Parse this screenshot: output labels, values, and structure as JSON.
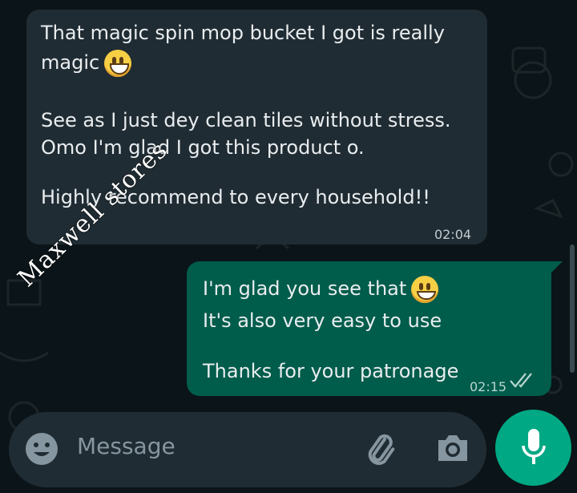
{
  "messages": {
    "incoming": {
      "lines": [
        "That magic spin mop bucket I got is really",
        "magic",
        "See as I just dey clean tiles without stress.",
        "Omo I'm glad I got this product o.",
        "Highly recommend to every household!!"
      ],
      "time": "02:04",
      "emoji": "grinning-face-icon"
    },
    "outgoing": {
      "lines": [
        "I'm glad you see that",
        "It's also very easy to use",
        "Thanks for your patronage"
      ],
      "time": "02:15",
      "status": "read-double-check",
      "emoji": "smiling-face-icon"
    }
  },
  "watermark": "Maxwell stores",
  "composer": {
    "placeholder": "Message"
  },
  "colors": {
    "incoming_bubble": "#202c33",
    "outgoing_bubble": "#005c4b",
    "mic_button": "#00a884",
    "background": "#0b1418"
  }
}
